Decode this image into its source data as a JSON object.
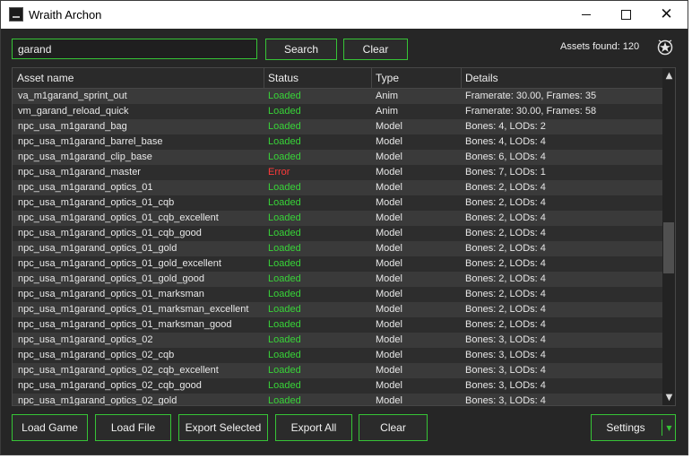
{
  "window": {
    "title": "Wraith Archon"
  },
  "search": {
    "value": "garand",
    "search_label": "Search",
    "clear_label": "Clear"
  },
  "assets_found": "Assets found: 120",
  "table": {
    "columns": [
      "Asset name",
      "Status",
      "Type",
      "Details"
    ],
    "rows": [
      {
        "name": "va_m1garand_sprint_out",
        "status": "Loaded",
        "type": "Anim",
        "details": "Framerate: 30.00, Frames: 35"
      },
      {
        "name": "vm_garand_reload_quick",
        "status": "Loaded",
        "type": "Anim",
        "details": "Framerate: 30.00, Frames: 58"
      },
      {
        "name": "npc_usa_m1garand_bag",
        "status": "Loaded",
        "type": "Model",
        "details": "Bones: 4, LODs: 2"
      },
      {
        "name": "npc_usa_m1garand_barrel_base",
        "status": "Loaded",
        "type": "Model",
        "details": "Bones: 4, LODs: 4"
      },
      {
        "name": "npc_usa_m1garand_clip_base",
        "status": "Loaded",
        "type": "Model",
        "details": "Bones: 6, LODs: 4"
      },
      {
        "name": "npc_usa_m1garand_master",
        "status": "Error",
        "type": "Model",
        "details": "Bones: 7, LODs: 1"
      },
      {
        "name": "npc_usa_m1garand_optics_01",
        "status": "Loaded",
        "type": "Model",
        "details": "Bones: 2, LODs: 4"
      },
      {
        "name": "npc_usa_m1garand_optics_01_cqb",
        "status": "Loaded",
        "type": "Model",
        "details": "Bones: 2, LODs: 4"
      },
      {
        "name": "npc_usa_m1garand_optics_01_cqb_excellent",
        "status": "Loaded",
        "type": "Model",
        "details": "Bones: 2, LODs: 4"
      },
      {
        "name": "npc_usa_m1garand_optics_01_cqb_good",
        "status": "Loaded",
        "type": "Model",
        "details": "Bones: 2, LODs: 4"
      },
      {
        "name": "npc_usa_m1garand_optics_01_gold",
        "status": "Loaded",
        "type": "Model",
        "details": "Bones: 2, LODs: 4"
      },
      {
        "name": "npc_usa_m1garand_optics_01_gold_excellent",
        "status": "Loaded",
        "type": "Model",
        "details": "Bones: 2, LODs: 4"
      },
      {
        "name": "npc_usa_m1garand_optics_01_gold_good",
        "status": "Loaded",
        "type": "Model",
        "details": "Bones: 2, LODs: 4"
      },
      {
        "name": "npc_usa_m1garand_optics_01_marksman",
        "status": "Loaded",
        "type": "Model",
        "details": "Bones: 2, LODs: 4"
      },
      {
        "name": "npc_usa_m1garand_optics_01_marksman_excellent",
        "status": "Loaded",
        "type": "Model",
        "details": "Bones: 2, LODs: 4"
      },
      {
        "name": "npc_usa_m1garand_optics_01_marksman_good",
        "status": "Loaded",
        "type": "Model",
        "details": "Bones: 2, LODs: 4"
      },
      {
        "name": "npc_usa_m1garand_optics_02",
        "status": "Loaded",
        "type": "Model",
        "details": "Bones: 3, LODs: 4"
      },
      {
        "name": "npc_usa_m1garand_optics_02_cqb",
        "status": "Loaded",
        "type": "Model",
        "details": "Bones: 3, LODs: 4"
      },
      {
        "name": "npc_usa_m1garand_optics_02_cqb_excellent",
        "status": "Loaded",
        "type": "Model",
        "details": "Bones: 3, LODs: 4"
      },
      {
        "name": "npc_usa_m1garand_optics_02_cqb_good",
        "status": "Loaded",
        "type": "Model",
        "details": "Bones: 3, LODs: 4"
      },
      {
        "name": "npc_usa_m1garand_optics_02_gold",
        "status": "Loaded",
        "type": "Model",
        "details": "Bones: 3, LODs: 4"
      }
    ]
  },
  "bottom": {
    "load_game": "Load Game",
    "load_file": "Load File",
    "export_selected": "Export Selected",
    "export_all": "Export All",
    "clear": "Clear",
    "settings": "Settings"
  },
  "icons": {
    "app": "app-icon",
    "logo": "wraith-logo-icon",
    "minimize": "minimize-icon",
    "maximize": "maximize-icon",
    "close": "close-icon",
    "scroll_up": "chevron-up-icon",
    "scroll_down": "chevron-down-icon",
    "settings_dropdown": "chevron-down-icon"
  },
  "colors": {
    "accent": "#36c436",
    "loaded": "#38d438",
    "error": "#ff3a3a",
    "background": "#262626"
  }
}
